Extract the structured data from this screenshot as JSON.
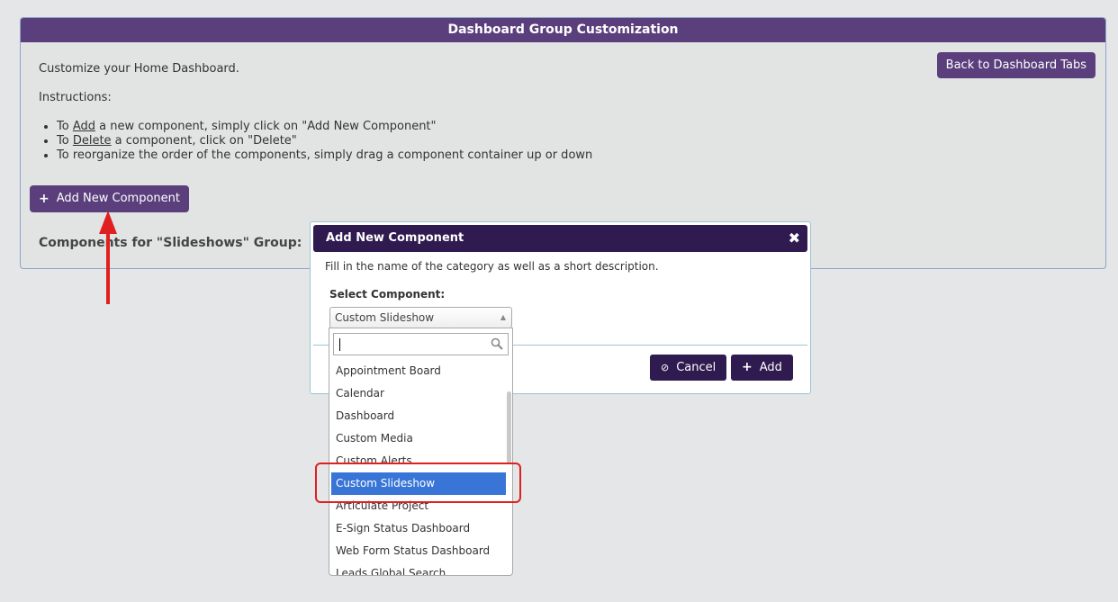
{
  "panel": {
    "title": "Dashboard Group Customization",
    "intro": "Customize your Home Dashboard.",
    "instructions_label": "Instructions:",
    "instructions": [
      {
        "pre": "To ",
        "keyword": "Add",
        "post": " a new component, simply click on \"Add New Component\""
      },
      {
        "pre": "To ",
        "keyword": "Delete",
        "post": " a component, click on \"Delete\""
      },
      {
        "pre": "",
        "keyword": "",
        "post": "To reorganize the order of the components, simply drag a component container up or down"
      }
    ],
    "back_button": "Back to Dashboard Tabs",
    "add_component_button": "Add New Component",
    "components_label": "Components for \"Slideshows\" Group:"
  },
  "dialog": {
    "title": "Add New Component",
    "close_icon": "close-icon",
    "description": "Fill in the name of the category as well as a short description.",
    "select_label": "Select Component:",
    "selected_value": "Custom Slideshow",
    "search_value": "",
    "cancel_button": "Cancel",
    "add_button": "Add"
  },
  "dropdown": {
    "options": [
      "Appointment Board",
      "Calendar",
      "Dashboard",
      "Custom Media",
      "Custom Alerts",
      "Custom Slideshow",
      "Articulate Project",
      "E-Sign Status Dashboard",
      "Web Form Status Dashboard",
      "Leads Global Search"
    ],
    "selected_index": 5
  },
  "colors": {
    "panel_header": "#5a3f7c",
    "dialog_header": "#2f1b4f",
    "selected_option": "#3875d7",
    "annotation": "#e02020"
  }
}
